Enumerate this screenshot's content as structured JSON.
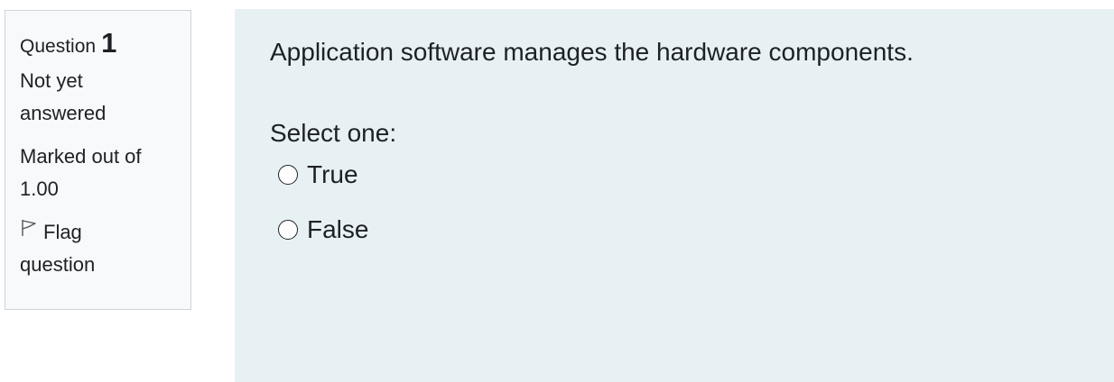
{
  "info": {
    "question_label": "Question",
    "question_number": "1",
    "state_line1": "Not yet",
    "state_line2": "answered",
    "grade_line1": "Marked out of",
    "grade_line2": "1.00",
    "flag_line1": "Flag",
    "flag_line2": "question",
    "flag_icon": "flag-outline-icon"
  },
  "question": {
    "text": "Application software manages the hardware components.",
    "prompt": "Select one:",
    "options": [
      {
        "label": "True",
        "selected": false
      },
      {
        "label": "False",
        "selected": false
      }
    ]
  },
  "colors": {
    "info_bg": "#f8f9fa",
    "info_border": "#cfd4da",
    "content_bg": "#e7f1f4",
    "text": "#1d2125"
  }
}
